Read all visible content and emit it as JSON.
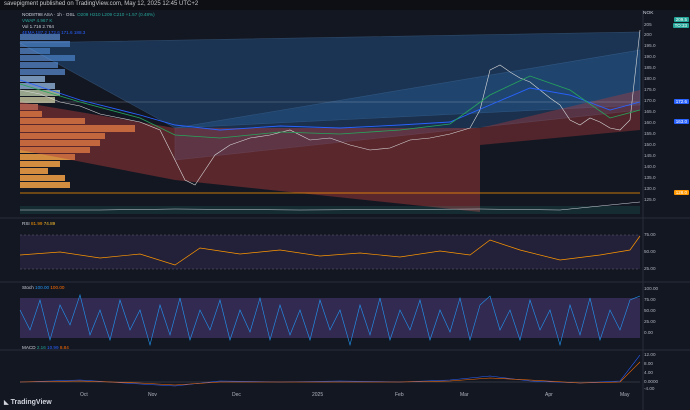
{
  "header": {
    "publisher_line": "savepigment published on TradingView.com, May 12, 2025 12:45 UTC+2"
  },
  "currency": "NOK",
  "legend": {
    "symbol": "NOD8T98 ASA · 1h · OSL",
    "vals": "O209 H210 L209 C210 +1.57 (0.48%)",
    "vwap": "VWAP 4.967 K",
    "vol": "Vol 1.716 2.764",
    "ema": "4EMA 187.2 172.6 171.6 188.3"
  },
  "price_axis": [
    "205",
    "200",
    "195.0",
    "190.0",
    "185.0",
    "180.0",
    "175.0",
    "170.0",
    "165.0",
    "160.0",
    "155.0",
    "150.0",
    "145.0",
    "140.0",
    "135.0",
    "130.0",
    "125.0"
  ],
  "price_tags": [
    {
      "label": "209.5",
      "color": "#26a69a"
    },
    {
      "label": "TO:33",
      "color": "#26a69a"
    },
    {
      "label": "172.6",
      "color": "#2962ff"
    },
    {
      "label": "163.0",
      "color": "#2962ff"
    },
    {
      "label": "128.0",
      "color": "#ff9800"
    }
  ],
  "rsi": {
    "label": "RSI",
    "v1": "81.99",
    "v2": "74.89",
    "axis": [
      "75.00",
      "50.00",
      "25.00"
    ]
  },
  "stoch": {
    "label": "Stoch",
    "v1": "100.00",
    "v2": "100.00",
    "axis": [
      "100.00",
      "75.00",
      "50.00",
      "25.00",
      "0.00"
    ]
  },
  "macd": {
    "label": "MACD",
    "v1": "2.16",
    "v2": "10.99",
    "v3": "8.84",
    "axis": [
      "12.00",
      "8.00",
      "4.00",
      "0.0000",
      "-4.00"
    ]
  },
  "x_axis": [
    "Oct",
    "Nov",
    "Dec",
    "2025",
    "Feb",
    "Mar",
    "Apr",
    "May"
  ],
  "branding": "TradingView",
  "colors": {
    "bg": "#131722",
    "up": "#26a69a",
    "down": "#ef5350",
    "ema_blue": "#2962ff",
    "ema_green": "#26a65b",
    "rsi": "#ff9800"
  }
}
